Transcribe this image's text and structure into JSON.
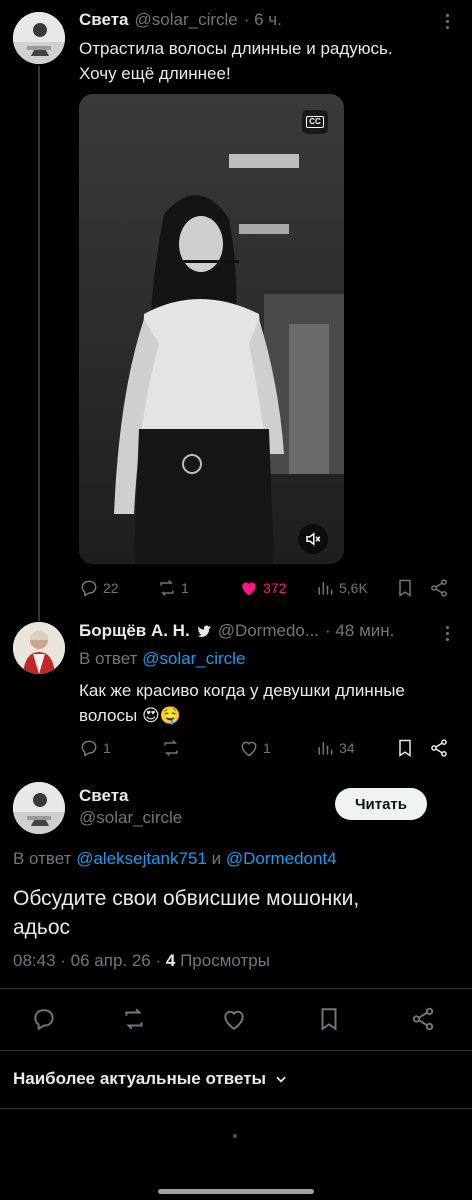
{
  "tweet1": {
    "name": "Света",
    "handle": "@solar_circle",
    "time": "· 6 ч.",
    "text_line1": "Отрастила волосы длинные и радуюсь.",
    "text_line2": "Хочу ещё длиннее!",
    "cc_label": "CC",
    "replies": "22",
    "retweets": "1",
    "likes": "372",
    "views": "5,6K",
    "likes_color": "#f91880"
  },
  "tweet2": {
    "name": "Борщёв А. Н.",
    "handle": "@Dormedo...",
    "time": "· 48 мин.",
    "reply_prefix": "В ответ",
    "reply_to": "@solar_circle",
    "text_line1": "Как же красиво когда у девушки длинные",
    "text_line2": "волосы",
    "emoji": "😍🤤",
    "replies": "1",
    "retweets": "",
    "likes": "1",
    "views": "34"
  },
  "main_tweet": {
    "name": "Света",
    "handle": "@solar_circle",
    "follow_label": "Читать",
    "reply_prefix": "В ответ",
    "reply_to_1": "@aleksejtank751",
    "reply_and": "и",
    "reply_to_2": "@Dormedont4",
    "text_line1": "Обсудите свои обвисшие мошонки,",
    "text_line2": "адьос",
    "timestamp": "08:43 · 06 апр. 26 ·",
    "views_count": "4",
    "views_label": "Просмотры"
  },
  "replies_header": {
    "label": "Наиболее актуальные ответы"
  },
  "colors": {
    "background": "#000000",
    "text": "#e7e9ea",
    "muted": "#71767b",
    "link": "#1d9bf0",
    "like": "#f91880"
  }
}
